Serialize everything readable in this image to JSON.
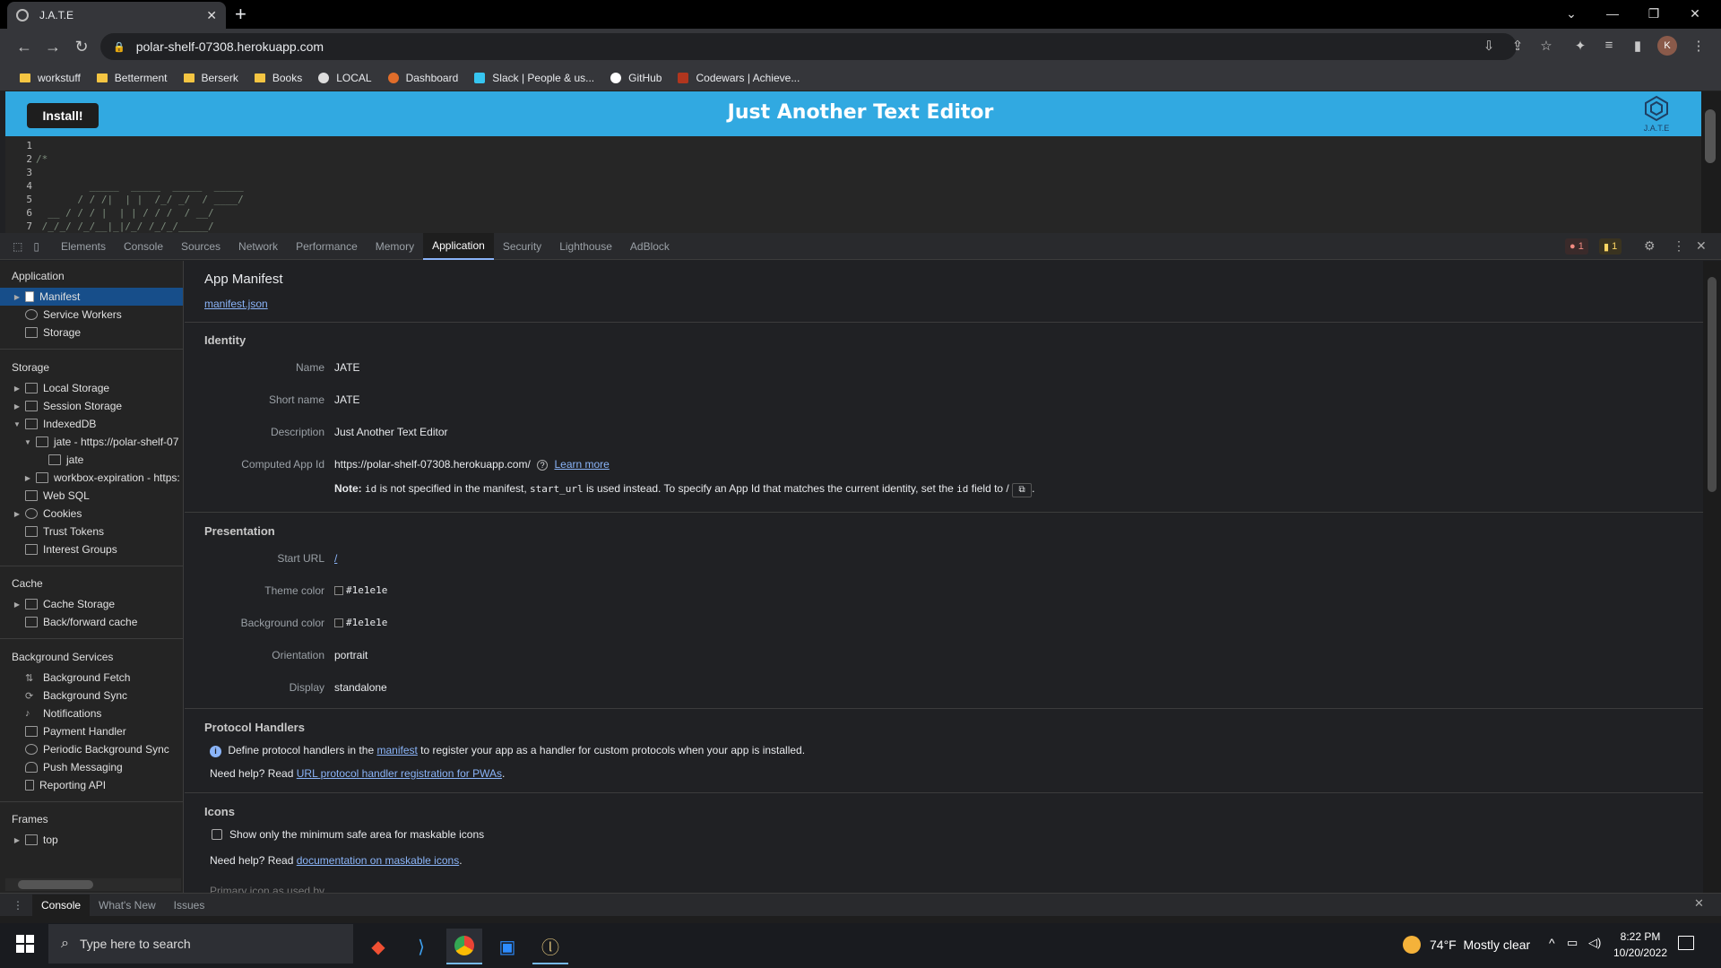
{
  "browser": {
    "tab_title": "J.A.T.E",
    "url": "polar-shelf-07308.herokuapp.com",
    "avatar_letter": "K",
    "bookmarks": [
      {
        "label": "workstuff",
        "type": "folder"
      },
      {
        "label": "Betterment",
        "type": "folder"
      },
      {
        "label": "Berserk",
        "type": "folder"
      },
      {
        "label": "Books",
        "type": "folder"
      },
      {
        "label": "LOCAL",
        "type": "site"
      },
      {
        "label": "Dashboard",
        "type": "site"
      },
      {
        "label": "Slack | People & us...",
        "type": "site"
      },
      {
        "label": "GitHub",
        "type": "site"
      },
      {
        "label": "Codewars | Achieve...",
        "type": "site"
      }
    ]
  },
  "page": {
    "install_label": "Install!",
    "title": "Just Another Text Editor",
    "logo_caption": "J.A.T.E",
    "header_color": "#31a9e1",
    "editor_lines": [
      {
        "n": "1",
        "code": ""
      },
      {
        "n": "2",
        "code": "/*"
      },
      {
        "n": "3",
        "code": ""
      },
      {
        "n": "4",
        "code": "         _____  _____  _____  _____"
      },
      {
        "n": "5",
        "code": "       / / /|  | |  /_/ _/  / ____/"
      },
      {
        "n": "6",
        "code": "  __ / / / |  | | / / /  / __/"
      },
      {
        "n": "7",
        "code": " /_/_/ /_/__|_|/_/ /_/_/_____/"
      }
    ]
  },
  "devtools": {
    "tabs": [
      "Elements",
      "Console",
      "Sources",
      "Network",
      "Performance",
      "Memory",
      "Application",
      "Security",
      "Lighthouse",
      "AdBlock"
    ],
    "active_tab": "Application",
    "error_count": "1",
    "warning_count": "1",
    "sidebar": {
      "application_header": "Application",
      "application_items": [
        "Manifest",
        "Service Workers",
        "Storage"
      ],
      "storage_header": "Storage",
      "storage_items": [
        "Local Storage",
        "Session Storage",
        "IndexedDB",
        "jate - https://polar-shelf-07",
        "jate",
        "workbox-expiration - https:",
        "Web SQL",
        "Cookies",
        "Trust Tokens",
        "Interest Groups"
      ],
      "cache_header": "Cache",
      "cache_items": [
        "Cache Storage",
        "Back/forward cache"
      ],
      "bg_header": "Background Services",
      "bg_items": [
        "Background Fetch",
        "Background Sync",
        "Notifications",
        "Payment Handler",
        "Periodic Background Sync",
        "Push Messaging",
        "Reporting API"
      ],
      "frames_header": "Frames",
      "frames_items": [
        "top"
      ]
    },
    "manifest": {
      "title": "App Manifest",
      "link": "manifest.json",
      "identity": {
        "header": "Identity",
        "name_label": "Name",
        "name": "JATE",
        "short_label": "Short name",
        "short_name": "JATE",
        "desc_label": "Description",
        "description": "Just Another Text Editor",
        "appid_label": "Computed App Id",
        "app_id": "https://polar-shelf-07308.herokuapp.com/",
        "learn_more": "Learn more",
        "note_bold": "Note:",
        "note_id": "id",
        "note_mid": "is not specified in the manifest,",
        "note_start": "start_url",
        "note_rest": "is used instead. To specify an App Id that matches the current identity, set the",
        "note_id2": "id",
        "note_end": "field to /",
        "note_period": "."
      },
      "presentation": {
        "header": "Presentation",
        "start_label": "Start URL",
        "start_url": "/",
        "theme_label": "Theme color",
        "theme_color": "#1e1e1e",
        "bg_label": "Background color",
        "bg_color": "#1e1e1e",
        "orient_label": "Orientation",
        "orientation": "portrait",
        "display_label": "Display",
        "display": "standalone"
      },
      "protocol": {
        "header": "Protocol Handlers",
        "info_pre": "Define protocol handlers in the",
        "info_link": "manifest",
        "info_post": "to register your app as a handler for custom protocols when your app is installed.",
        "help_pre": "Need help? Read",
        "help_link": "URL protocol handler registration for PWAs",
        "help_post": "."
      },
      "icons": {
        "header": "Icons",
        "checkbox_label": "Show only the minimum safe area for maskable icons",
        "help_pre": "Need help? Read",
        "help_link": "documentation on maskable icons",
        "help_post": ".",
        "primary": "Primary icon as used by"
      }
    },
    "drawer_tabs": [
      "Console",
      "What's New",
      "Issues"
    ]
  },
  "taskbar": {
    "search_placeholder": "Type here to search",
    "temp": "74°F",
    "weather": "Mostly clear",
    "time": "8:22 PM",
    "date": "10/20/2022"
  }
}
